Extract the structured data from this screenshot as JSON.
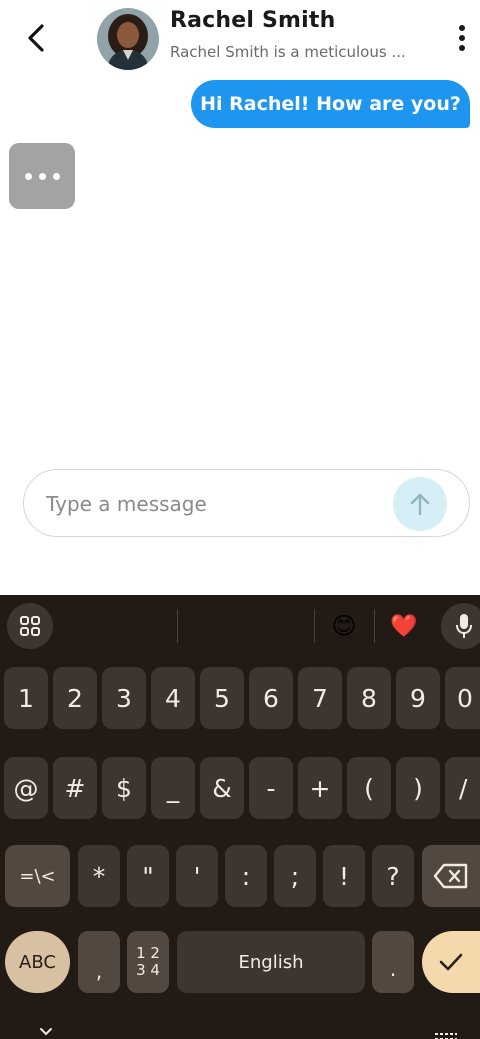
{
  "header": {
    "contact_name": "Rachel Smith",
    "contact_description": "Rachel Smith is a meticulous ...",
    "colors": {
      "text": "#1a1a1a",
      "subtext": "#6a6a6a"
    }
  },
  "messages": [
    {
      "direction": "outgoing",
      "text": "Hi Rachel! How are you?",
      "color": "#1e96f0"
    }
  ],
  "typing_indicator": {
    "visible": true,
    "color": "#a3a3a3"
  },
  "composer": {
    "placeholder": "Type a message",
    "value": ""
  },
  "keyboard": {
    "toolbar": {
      "emoji_glyph": "😊",
      "heart_glyph": "❤️"
    },
    "row1": [
      "1",
      "2",
      "3",
      "4",
      "5",
      "6",
      "7",
      "8",
      "9",
      "0"
    ],
    "row2": [
      "@",
      "#",
      "$",
      "_",
      "&",
      "-",
      "+",
      "(",
      ")",
      "/"
    ],
    "row3": [
      "=\\<",
      "*",
      "\"",
      "'",
      ":",
      ";",
      "!",
      "?"
    ],
    "row4": {
      "abc": "ABC",
      "comma": ",",
      "num_top": "1 2",
      "num_bottom": "3 4",
      "space": "English",
      "period": "."
    },
    "colors": {
      "background": "#221a14",
      "key": "#3d3630",
      "accent": "#f3d9ac"
    }
  }
}
